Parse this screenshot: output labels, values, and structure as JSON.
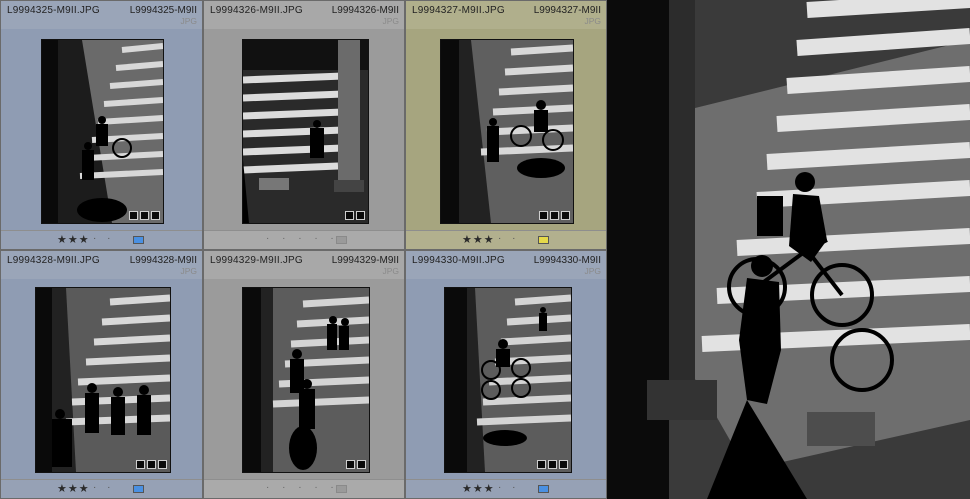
{
  "colors": {
    "blue_bg": "#8f9cb3",
    "gray_bg": "#9b9b9b",
    "yellow_bg": "#a6a57f",
    "label_blue": "#4a90e2",
    "label_yellow": "#e5d94a",
    "label_none": "#9a9a9a"
  },
  "cells": [
    {
      "name": "L9994325-M9II.JPG",
      "short": "L9994325-M9II",
      "type": "JPG",
      "rating": "★★★",
      "unrated": "· ·",
      "label": "blue"
    },
    {
      "name": "L9994326-M9II.JPG",
      "short": "L9994326-M9II",
      "type": "JPG",
      "rating": "",
      "unrated": "· · · · ·",
      "label": "none"
    },
    {
      "name": "L9994327-M9II.JPG",
      "short": "L9994327-M9II",
      "type": "JPG",
      "rating": "★★★",
      "unrated": "· ·",
      "label": "yellow"
    },
    {
      "name": "L9994328-M9II.JPG",
      "short": "L9994328-M9II",
      "type": "JPG",
      "rating": "★★★",
      "unrated": "· ·",
      "label": "blue"
    },
    {
      "name": "L9994329-M9II.JPG",
      "short": "L9994329-M9II",
      "type": "JPG",
      "rating": "",
      "unrated": "· · · · ·",
      "label": "none"
    },
    {
      "name": "L9994330-M9II.JPG",
      "short": "L9994330-M9II",
      "type": "JPG",
      "rating": "★★★",
      "unrated": "· ·",
      "label": "blue"
    }
  ]
}
